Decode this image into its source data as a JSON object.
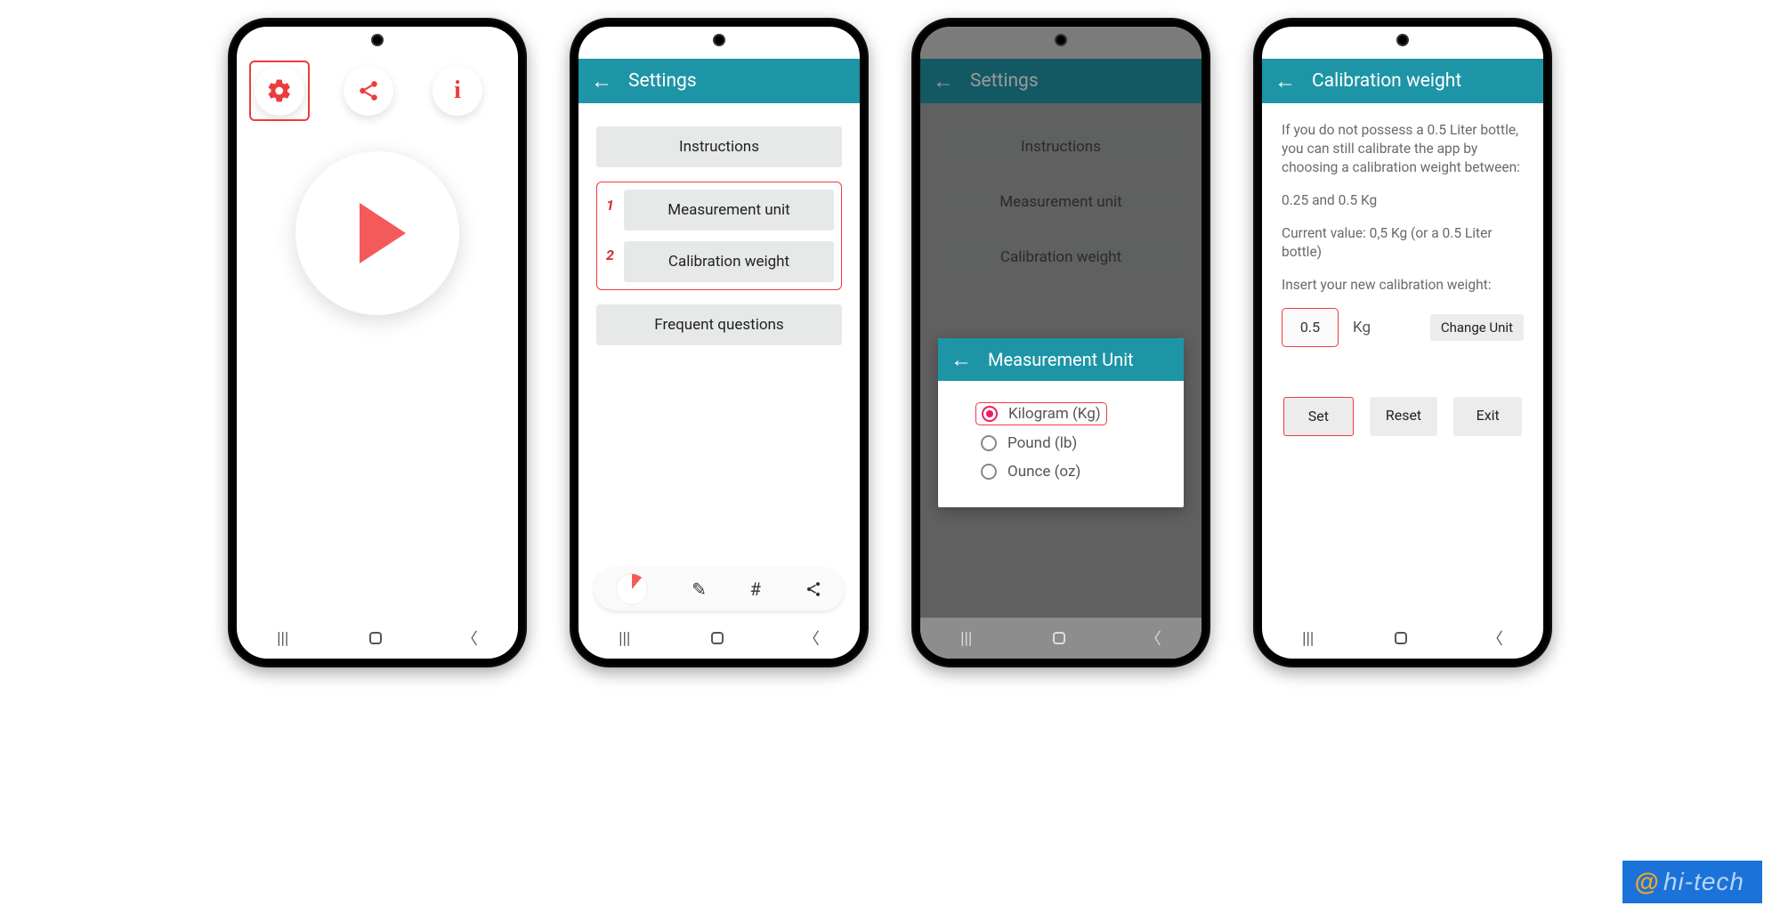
{
  "screen1": {
    "icons": {
      "gear": "⚙",
      "share": "share",
      "info": "i"
    }
  },
  "screen2": {
    "title": "Settings",
    "buttons": {
      "instructions": "Instructions",
      "measurement": "Measurement unit",
      "calibration": "Calibration weight",
      "faq": "Frequent questions"
    },
    "badge1": "1",
    "badge2": "2"
  },
  "screen3": {
    "title": "Settings",
    "buttons": {
      "instructions": "Instructions",
      "measurement": "Measurement unit",
      "calibration": "Calibration weight"
    },
    "popup_title": "Measurement Unit",
    "options": {
      "kg": "Kilogram (Kg)",
      "lb": "Pound (lb)",
      "oz": "Ounce (oz)"
    }
  },
  "screen4": {
    "title": "Calibration weight",
    "p1": "If you do not possess a 0.5 Liter bottle, you can still calibrate the app by choosing a calibration weight between:",
    "p2": "0.25 and 0.5 Kg",
    "p3": "Current value: 0,5 Kg (or a 0.5 Liter bottle)",
    "p4": "Insert your new calibration weight:",
    "input_value": "0.5",
    "unit": "Kg",
    "change": "Change Unit",
    "set": "Set",
    "reset": "Reset",
    "exit": "Exit"
  },
  "watermark": "hi-tech"
}
